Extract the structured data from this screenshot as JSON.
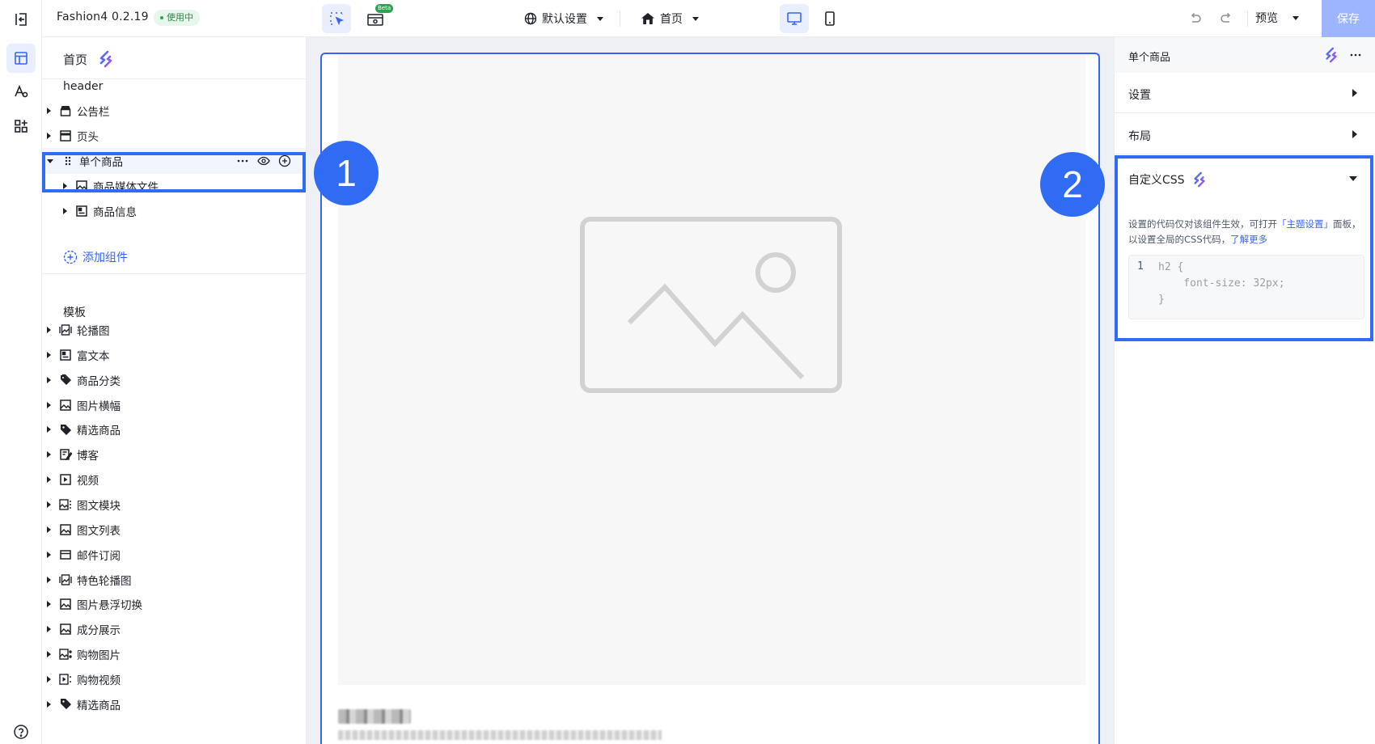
{
  "theme": {
    "name": "Fashion4 0.2.19",
    "badge": "使用中"
  },
  "topbar": {
    "beta_label": "Beta",
    "language_select": "默认设置",
    "page_select": "首页",
    "preview_label": "预览",
    "save_label": "保存"
  },
  "left_panel": {
    "page_title": "首页",
    "header_section": "header",
    "header_items": [
      {
        "label": "公告栏",
        "icon": "storefront-icon"
      },
      {
        "label": "页头",
        "icon": "header-layout-icon"
      },
      {
        "label": "单个商品",
        "icon": "drag-handle-icon"
      },
      {
        "label": "商品媒体文件",
        "icon": "image-icon"
      },
      {
        "label": "商品信息",
        "icon": "info-card-icon"
      }
    ],
    "add_component_label": "添加组件",
    "template_section": "模板",
    "template_items": [
      {
        "label": "轮播图",
        "icon": "carousel-icon"
      },
      {
        "label": "富文本",
        "icon": "richtext-icon"
      },
      {
        "label": "商品分类",
        "icon": "tags-icon"
      },
      {
        "label": "图片横幅",
        "icon": "image-icon"
      },
      {
        "label": "精选商品",
        "icon": "tag-icon"
      },
      {
        "label": "博客",
        "icon": "blog-icon"
      },
      {
        "label": "视频",
        "icon": "video-icon"
      },
      {
        "label": "图文模块",
        "icon": "image-text-icon"
      },
      {
        "label": "图文列表",
        "icon": "image-icon"
      },
      {
        "label": "邮件订阅",
        "icon": "mail-icon"
      },
      {
        "label": "特色轮播图",
        "icon": "carousel-icon"
      },
      {
        "label": "图片悬浮切换",
        "icon": "image-icon"
      },
      {
        "label": "成分展示",
        "icon": "image-icon"
      },
      {
        "label": "购物图片",
        "icon": "shopping-image-icon"
      },
      {
        "label": "购物视频",
        "icon": "shopping-video-icon"
      },
      {
        "label": "精选商品",
        "icon": "tag-icon"
      }
    ]
  },
  "right_panel": {
    "title": "单个商品",
    "sections": [
      {
        "label": "设置"
      },
      {
        "label": "布局"
      }
    ],
    "custom_css": {
      "title": "自定义CSS",
      "desc_part1": "设置的代码仅对该组件生效，可打开",
      "desc_link1": "「主题设置」",
      "desc_part2": "面板，以设置全局的CSS代码，",
      "desc_link2": "了解更多",
      "line_number": "1",
      "code_lines": [
        "h2 {",
        "    font-size: 32px;",
        "}"
      ]
    }
  },
  "callouts": {
    "first": "1",
    "second": "2"
  },
  "colors": {
    "accent": "#3a64f5",
    "highlight": "#2f6cf3",
    "save": "#9db5ff",
    "badge_green": "#2ea34f"
  }
}
